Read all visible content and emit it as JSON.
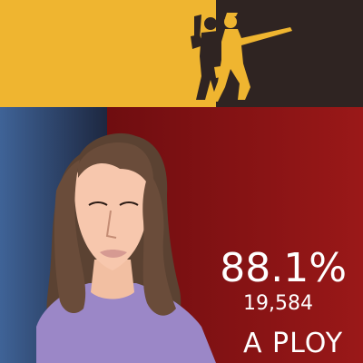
{
  "stats": {
    "percent": "88.1%",
    "count": "19,584",
    "answer": "A PLOY"
  },
  "colors": {
    "banner_yellow": "#efb530",
    "banner_dark": "#2f2422",
    "panel_blue": "#3f5f8c",
    "panel_red": "#8f1414",
    "text": "#ffffff"
  },
  "icons": {
    "banner": "silhouette-fighters-icon",
    "portrait": "woman-portrait-illustration"
  }
}
